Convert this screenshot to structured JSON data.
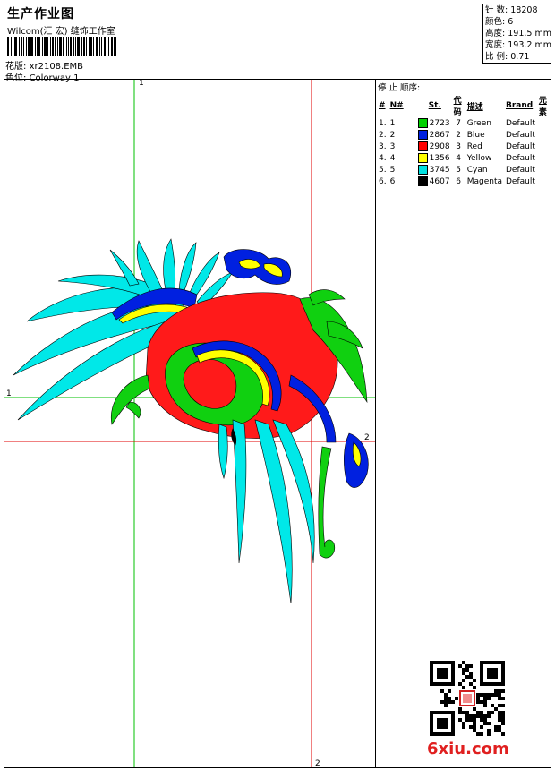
{
  "header": {
    "title": "生产作业图",
    "company": "Wilcom(汇 宏) 缝饰工作室",
    "design_label": "花版:",
    "design_value": "xr2108.EMB",
    "color_label": "色位:",
    "color_value": "Colorway 1"
  },
  "stats": [
    {
      "label": "针 数:",
      "value": "18208"
    },
    {
      "label": "颜色:",
      "value": "6"
    },
    {
      "label": "高度:",
      "value": "191.5 mm"
    },
    {
      "label": "宽度:",
      "value": "193.2 mm"
    },
    {
      "label": "比 例:",
      "value": "0.71"
    }
  ],
  "stop_sequence": {
    "title": "停 止 顺序:",
    "headers": [
      "#",
      "N#",
      "St.",
      "代码",
      "描述",
      "Brand",
      "元素"
    ],
    "rows": [
      {
        "idx": "1.",
        "n": "1",
        "color": "#00d000",
        "st": "2723",
        "code": "7",
        "desc": "Green",
        "brand": "Default"
      },
      {
        "idx": "2.",
        "n": "2",
        "color": "#0020e0",
        "st": "2867",
        "code": "2",
        "desc": "Blue",
        "brand": "Default"
      },
      {
        "idx": "3.",
        "n": "3",
        "color": "#ff0000",
        "st": "2908",
        "code": "3",
        "desc": "Red",
        "brand": "Default"
      },
      {
        "idx": "4.",
        "n": "4",
        "color": "#ffff00",
        "st": "1356",
        "code": "4",
        "desc": "Yellow",
        "brand": "Default"
      },
      {
        "idx": "5.",
        "n": "5",
        "color": "#00e0e0",
        "st": "3745",
        "code": "5",
        "desc": "Cyan",
        "brand": "Default"
      },
      {
        "idx": "6.",
        "n": "6",
        "color": "#000000",
        "st": "4607",
        "code": "6",
        "desc": "Magenta",
        "brand": "Default"
      }
    ]
  },
  "guides": {
    "green_top": "1",
    "green_left": "1",
    "red_right": "2",
    "red_bottom": "2"
  },
  "watermark": "6xiu.com",
  "colors": {
    "guide_green": "#00c000",
    "guide_red": "#e00000"
  }
}
